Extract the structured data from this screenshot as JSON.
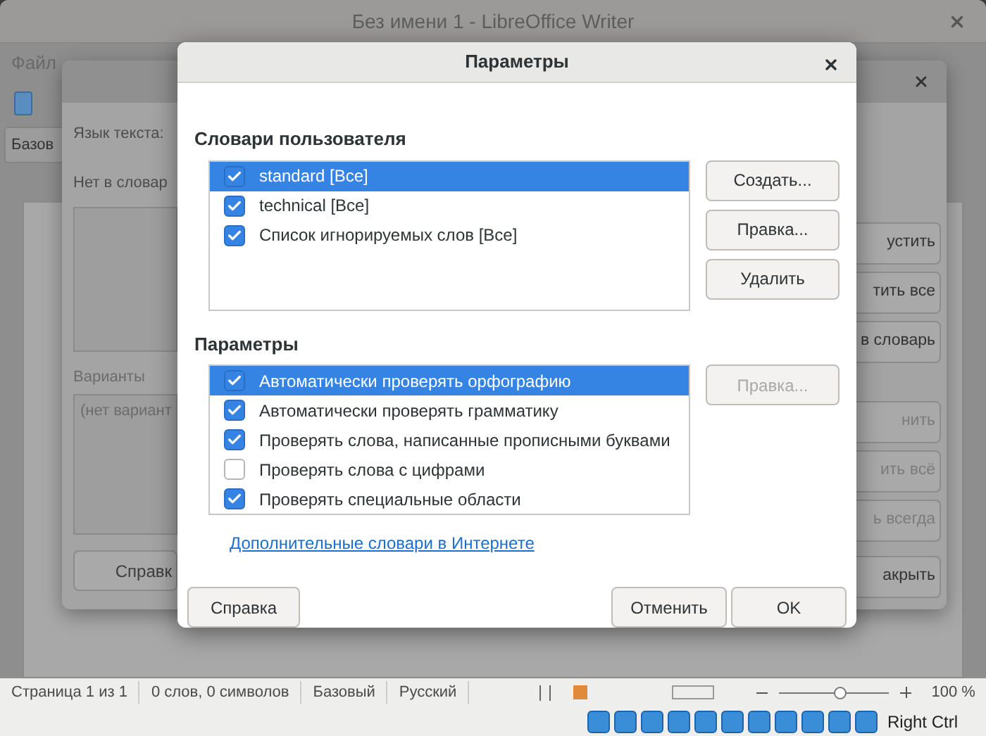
{
  "writer": {
    "title": "Без имени 1 - LibreOffice Writer",
    "menu": [
      "Файл"
    ],
    "style_box": "Базов"
  },
  "spelling_dialog": {
    "language_label": "Язык текста:",
    "not_in_dict_label": "Нет в словар",
    "suggestions_label": "Варианты",
    "suggestions_text": "(нет вариант",
    "help_button": "Справк",
    "buttons": [
      {
        "label": "устить",
        "disabled": false
      },
      {
        "label": "тить все",
        "disabled": false
      },
      {
        "label": "в словарь",
        "disabled": false
      },
      {
        "label": "нить",
        "disabled": true
      },
      {
        "label": "ить всё",
        "disabled": true
      },
      {
        "label": "ь всегда",
        "disabled": true
      },
      {
        "label": "акрыть",
        "disabled": false
      }
    ]
  },
  "options_dialog": {
    "title": "Параметры",
    "dictionaries_label": "Словари пользователя",
    "dictionaries": [
      {
        "label": "standard [Все]",
        "checked": true,
        "selected": true
      },
      {
        "label": "technical [Все]",
        "checked": true,
        "selected": false
      },
      {
        "label": "Список игнорируемых слов [Все]",
        "checked": true,
        "selected": false
      }
    ],
    "dictionary_buttons": [
      {
        "label": "Создать...",
        "disabled": false
      },
      {
        "label": "Правка...",
        "disabled": false
      },
      {
        "label": "Удалить",
        "disabled": false
      }
    ],
    "options_label": "Параметры",
    "options": [
      {
        "label": "Автоматически проверять орфографию",
        "checked": true,
        "selected": true
      },
      {
        "label": "Автоматически проверять грамматику",
        "checked": true,
        "selected": false
      },
      {
        "label": "Проверять слова, написанные прописными буквами",
        "checked": true,
        "selected": false
      },
      {
        "label": "Проверять слова с цифрами",
        "checked": false,
        "selected": false
      },
      {
        "label": "Проверять специальные области",
        "checked": true,
        "selected": false
      }
    ],
    "options_edit_button": {
      "label": "Правка...",
      "disabled": true
    },
    "link": "Дополнительные словари в Интернете",
    "help_button": "Справка",
    "cancel_button": "Отменить",
    "ok_button": "OK"
  },
  "status_bar": {
    "page": "Страница 1 из 1",
    "words": "0 слов, 0 символов",
    "style": "Базовый",
    "language": "Русский",
    "zoom": {
      "level": 0.55
    },
    "zoom_label": "100 %"
  },
  "host_bar": {
    "key": "Right Ctrl"
  }
}
